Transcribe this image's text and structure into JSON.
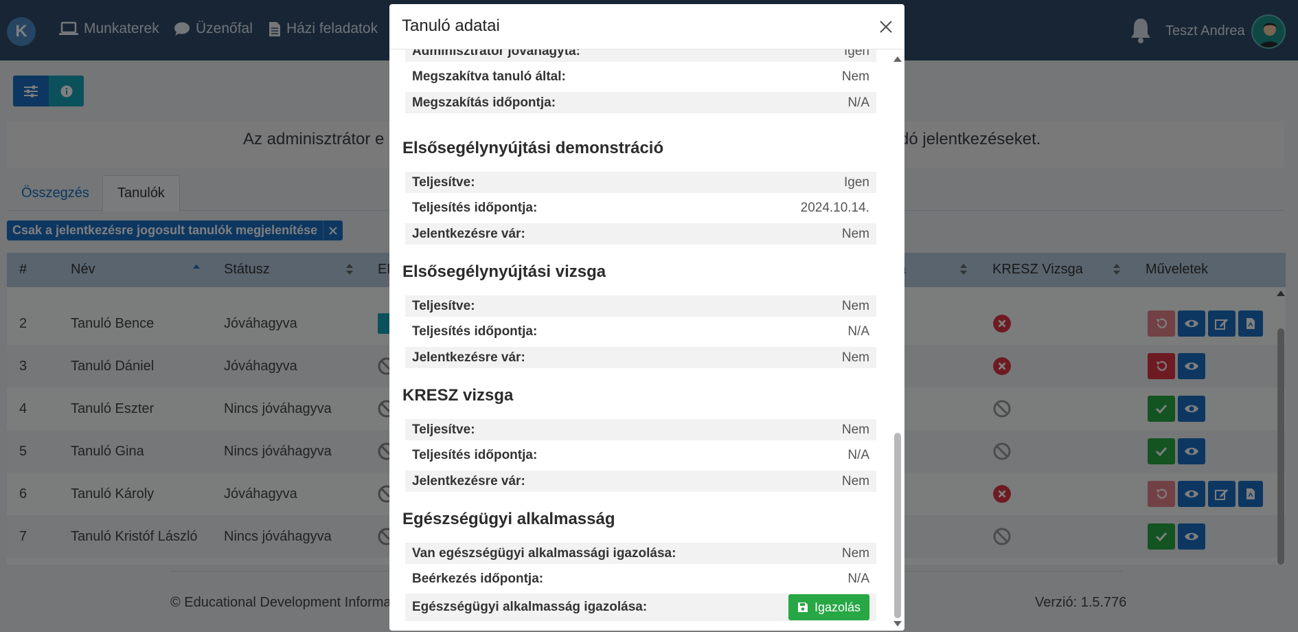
{
  "navbar": {
    "logo": "K",
    "items": [
      {
        "label": "Munkaterek",
        "icon": "laptop-icon"
      },
      {
        "label": "Üzenőfal",
        "icon": "comment-icon"
      },
      {
        "label": "Házi feladatok",
        "icon": "file-icon"
      }
    ],
    "user_name": "Teszt Andrea"
  },
  "page": {
    "info_text_left": "Az adminisztrátor e",
    "info_text_right": "dó jelentkezéseket.",
    "tabs": [
      "Összegzés",
      "Tanulók"
    ],
    "filter_chip": "Csak a jelentkezésre jogosult tanulók megjelenítése",
    "table": {
      "headers": [
        "#",
        "Név",
        "Státusz",
        "EN",
        "a",
        "KRESZ Vizsga",
        "Műveletek"
      ],
      "rows": [
        {
          "num": "2",
          "name": "Tanuló Bence",
          "status": "Jóváhagyva",
          "kresz": "x",
          "actions": [
            "undo-faded",
            "view",
            "edit",
            "pdf"
          ]
        },
        {
          "num": "3",
          "name": "Tanuló Dániel",
          "status": "Jóváhagyva",
          "kresz": "x",
          "actions": [
            "undo",
            "view"
          ]
        },
        {
          "num": "4",
          "name": "Tanuló Eszter",
          "status": "Nincs jóváhagyva",
          "kresz": "ban",
          "actions": [
            "check",
            "view"
          ]
        },
        {
          "num": "5",
          "name": "Tanuló Gina",
          "status": "Nincs jóváhagyva",
          "kresz": "ban",
          "actions": [
            "check",
            "view"
          ]
        },
        {
          "num": "6",
          "name": "Tanuló Károly",
          "status": "Jóváhagyva",
          "kresz": "x",
          "actions": [
            "undo-faded",
            "view",
            "edit",
            "pdf"
          ]
        },
        {
          "num": "7",
          "name": "Tanuló Kristóf László",
          "status": "Nincs jóváhagyva",
          "kresz": "ban",
          "actions": [
            "check",
            "view"
          ]
        }
      ]
    },
    "footer_left": "© Educational Development Informa",
    "footer_right": "Verzió: 1.5.776"
  },
  "modal": {
    "title": "Tanuló adatai",
    "top_rows": [
      {
        "label": "Adminisztrátor jóváhagyta:",
        "value": "Igen"
      },
      {
        "label": "Megszakítva tanuló által:",
        "value": "Nem"
      },
      {
        "label": "Megszakítás időpontja:",
        "value": "N/A"
      }
    ],
    "sections": [
      {
        "title": "Elsősegélynyújtási demonstráció",
        "rows": [
          {
            "label": "Teljesítve:",
            "value": "Igen"
          },
          {
            "label": "Teljesítés időpontja:",
            "value": "2024.10.14."
          },
          {
            "label": "Jelentkezésre vár:",
            "value": "Nem"
          }
        ]
      },
      {
        "title": "Elsősegélynyújtási vizsga",
        "rows": [
          {
            "label": "Teljesítve:",
            "value": "Nem"
          },
          {
            "label": "Teljesítés időpontja:",
            "value": "N/A"
          },
          {
            "label": "Jelentkezésre vár:",
            "value": "Nem"
          }
        ]
      },
      {
        "title": "KRESZ vizsga",
        "rows": [
          {
            "label": "Teljesítve:",
            "value": "Nem"
          },
          {
            "label": "Teljesítés időpontja:",
            "value": "N/A"
          },
          {
            "label": "Jelentkezésre vár:",
            "value": "Nem"
          }
        ]
      },
      {
        "title": "Egészségügyi alkalmasság",
        "rows": [
          {
            "label": "Van egészségügyi alkalmassági igazolása:",
            "value": "Nem"
          },
          {
            "label": "Beérkezés időpontja:",
            "value": "N/A"
          },
          {
            "label": "Egészségügyi alkalmasság igazolása:",
            "value": ""
          }
        ]
      }
    ],
    "igazolas_button": "Igazolás"
  },
  "colors": {
    "navbar": "#2e4a6b",
    "primary": "#1b6ec2",
    "info": "#17a2b8",
    "success": "#28a745",
    "danger": "#dc3545"
  }
}
